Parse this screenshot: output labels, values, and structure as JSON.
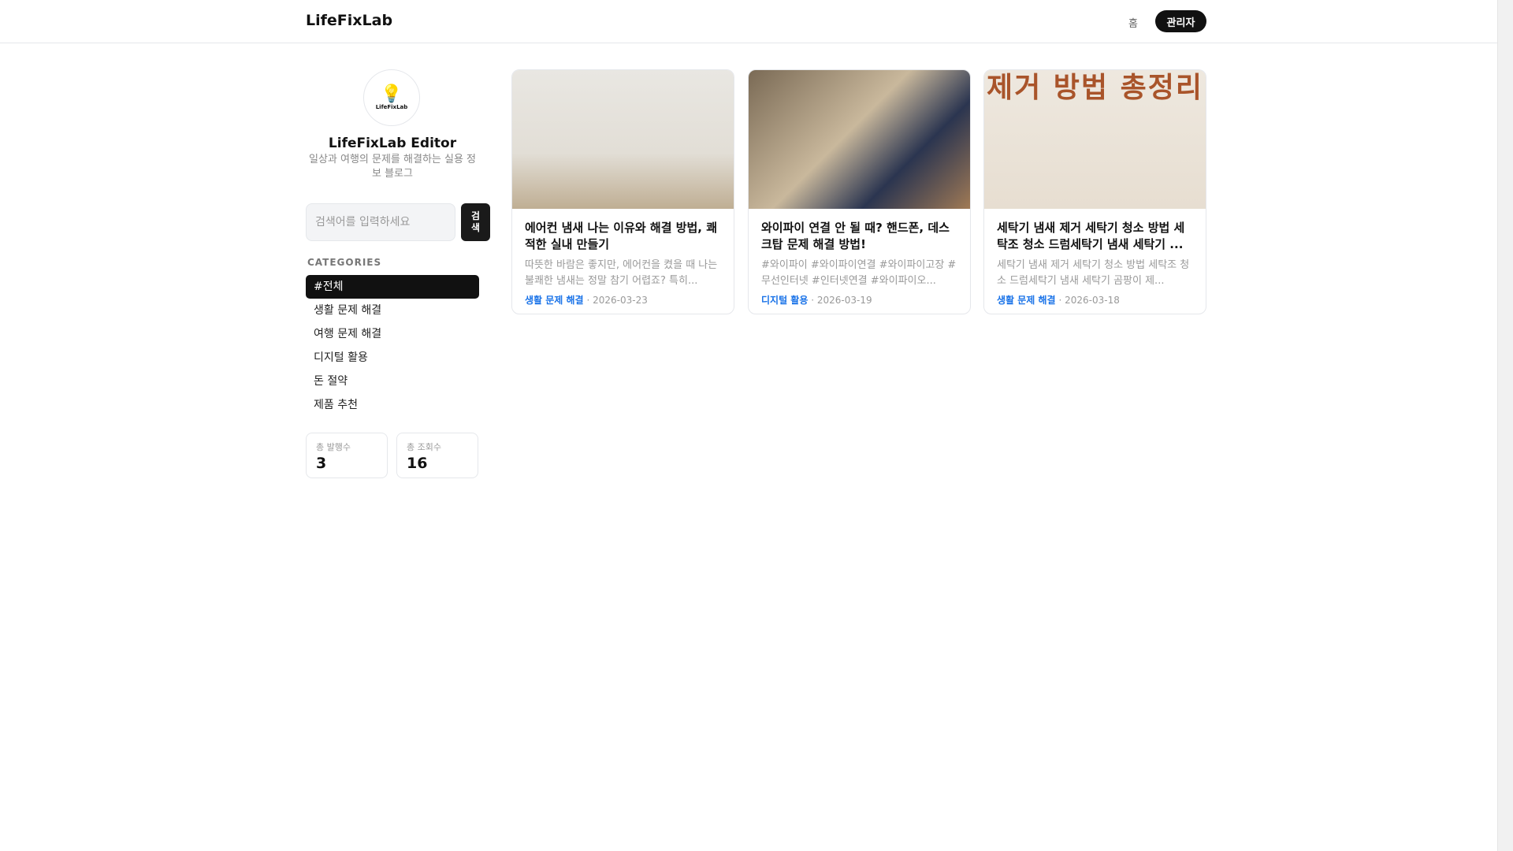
{
  "header": {
    "brand": "LifeFixLab",
    "nav_home": "홈",
    "admin_label": "관리자"
  },
  "profile": {
    "logo_text": "LifeFixLab",
    "name": "LifeFixLab Editor",
    "description": "일상과 여행의 문제를 해결하는 실용 정보 블로그"
  },
  "search": {
    "placeholder": "검색어를 입력하세요",
    "button_label": "검색"
  },
  "categories": {
    "title": "CATEGORIES",
    "items": [
      "#전체",
      "생활 문제 해결",
      "여행 문제 해결",
      "디지털 활용",
      "돈 절약",
      "제품 추천"
    ],
    "active_index": 0
  },
  "stats": [
    {
      "label": "총 발행수",
      "value": "3"
    },
    {
      "label": "총 조회수",
      "value": "16"
    }
  ],
  "posts": [
    {
      "title": "에어컨 냄새 나는 이유와 해결 방법, 쾌적한 실내 만들기",
      "excerpt": "따뜻한 바람은 좋지만, 에어컨을 켰을 때 나는 불쾌한 냄새는 정말 참기 어렵죠? 특히...",
      "category": "생활 문제 해결",
      "date": "2026-03-23"
    },
    {
      "title": "와이파이 연결 안 될 때? 핸드폰, 데스크탑 문제 해결 방법!",
      "excerpt": "#와이파이 #와이파이연결 #와이파이고장 #무선인터넷 #인터넷연결 #와이파이오...",
      "category": "디지털 활용",
      "date": "2026-03-19"
    },
    {
      "title": "세탁기 냄새 제거 세탁기 청소 방법 세탁조 청소 드럼세탁기 냄새 세탁기 ...",
      "excerpt": "세탁기 냄새 제거 세탁기 청소 방법 세탁조 청소 드럼세탁기 냄새 세탁기 곰팡이 제...",
      "category": "생활 문제 해결",
      "date": "2026-03-18",
      "image_overlay_text": "제거 방법 총정리"
    }
  ],
  "meta_separator": "·"
}
